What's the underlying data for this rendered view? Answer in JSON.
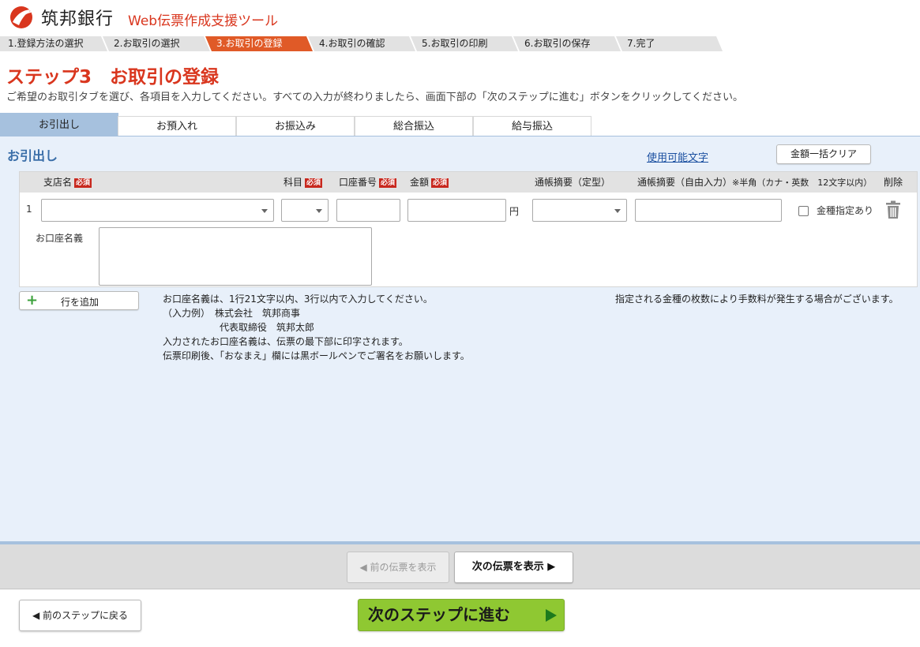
{
  "header": {
    "bank_name": "筑邦銀行",
    "tool_name": "Web伝票作成支援ツール"
  },
  "steps": [
    {
      "label": "1.登録方法の選択",
      "active": false
    },
    {
      "label": "2.お取引の選択",
      "active": false
    },
    {
      "label": "3.お取引の登録",
      "active": true
    },
    {
      "label": "4.お取引の確認",
      "active": false
    },
    {
      "label": "5.お取引の印刷",
      "active": false
    },
    {
      "label": "6.お取引の保存",
      "active": false
    },
    {
      "label": "7.完了",
      "active": false
    }
  ],
  "page": {
    "title": "ステップ3　お取引の登録",
    "description": "ご希望のお取引タブを選び、各項目を入力してください。すべての入力が終わりましたら、画面下部の「次のステップに進む」ボタンをクリックしてください。"
  },
  "tabs": [
    {
      "label": "お引出し",
      "active": true
    },
    {
      "label": "お預入れ",
      "active": false
    },
    {
      "label": "お振込み",
      "active": false
    },
    {
      "label": "総合振込",
      "active": false
    },
    {
      "label": "給与振込",
      "active": false
    }
  ],
  "panel": {
    "title": "お引出し",
    "usable_chars_link": "使用可能文字",
    "clear_amount_button": "金額一括クリア"
  },
  "table": {
    "required_badge": "必須",
    "headers": {
      "branch": "支店名",
      "subject": "科目",
      "account": "口座番号",
      "amount": "金額",
      "memo_fixed": "通帳摘要（定型）",
      "memo_free": "通帳摘要（自由入力）",
      "memo_free_note": "※半角（カナ・英数　12文字以内）",
      "delete": "削除"
    },
    "row": {
      "number": "1",
      "branch_value": "",
      "subject_value": "",
      "account_value": "",
      "amount_value": "",
      "yen_unit": "円",
      "memo_fixed_value": "",
      "memo_free_value": "",
      "denomination_label": "金種指定あり",
      "denomination_checked": false,
      "account_name_label": "お口座名義",
      "account_name_value": ""
    }
  },
  "add_row_button": "行を追加",
  "notes": {
    "line1": "お口座名義は、1行21文字以内、3行以内で入力してください。",
    "example_label": "（入力例）",
    "example_line1": "株式会社　筑邦商事",
    "example_line2": "代表取締役　筑邦太郎",
    "line4": "入力されたお口座名義は、伝票の最下部に印字されます。",
    "line5": "伝票印刷後、「おなまえ」欄には黒ボールペンでご署名をお願いします。",
    "fee_note": "指定される金種の枚数により手数料が発生する場合がございます。"
  },
  "slip_nav": {
    "prev_label": "◀ 前の伝票を表示",
    "next_label": "次の伝票を表示 ▶"
  },
  "footer": {
    "back_label": "◀ 前のステップに戻る",
    "next_step_label": "次のステップに進む"
  },
  "colors": {
    "brand_red": "#d9361e",
    "step_active": "#e05a27",
    "tab_active": "#a6c1de",
    "panel_bg": "#e8f0fa",
    "next_step_green": "#8fc832"
  }
}
